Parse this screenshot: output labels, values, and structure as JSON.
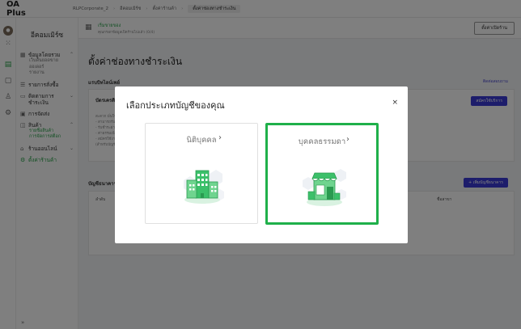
{
  "app": {
    "brand": "OA Plus"
  },
  "breadcrumb": [
    "RLPCorporate_2",
    "อีคอมเมิร์ซ",
    "ตั้งค่าร้านค้า",
    "ตั้งค่าช่องทางชำระเงิน"
  ],
  "sidebar": {
    "store_name": "อีคอมเมิร์ซ",
    "groups": [
      {
        "label": "ข้อมูลโดยรวม",
        "subs": [
          "เว็บดันยอดขาย",
          "ออเดอร์",
          "รายงาน"
        ]
      },
      {
        "label": "รายการสั่งซื้อ",
        "subs": []
      },
      {
        "label": "ติดตามการชำระเงิน",
        "subs": []
      },
      {
        "label": "การจัดส่ง",
        "subs": []
      },
      {
        "label": "สินค้า",
        "subs": [
          "รายชื่อสินค้า",
          "การจัดการสต็อก"
        ]
      },
      {
        "label": "ร้านออนไลน์",
        "subs": []
      },
      {
        "label": "ตั้งค่าร้านค้า",
        "subs": []
      }
    ],
    "collapse_icon": "double-chevron-icon"
  },
  "subheader": {
    "title": "เริ่มขายของ",
    "desc": "คุณกรอกข้อมูลเปิดร้านไปแล้ว (0/4)",
    "button": "ตั้งค่าเปิดร้าน"
  },
  "main": {
    "page_title": "ตั้งค่าช่องทางชำระเงิน",
    "section_online": "แรบบิทไลน์เพย์",
    "help_link": "ติดต่อสอบถาม",
    "card_title": "บัตรเครดิต",
    "card_button": "สมัครใช้บริการ",
    "card_lines": [
      "สะดวก มั่นใจ",
      "- สามารถรับ",
      "- รับชำระผ่าน",
      "- ค่าธรรมเนียม",
      "- สมัครใช้งานง่าย",
      "(สำหรับบัญชี)"
    ],
    "section_bank": "บัญชีธนาคาร",
    "add_bank_button": "+ เพิ่มบัญชีธนาคาร",
    "table_headers": [
      "ลำดับ",
      "ชื่อสาขา"
    ]
  },
  "modal": {
    "title": "เลือกประเภทบัญชีของคุณ",
    "close_label": "×",
    "options": [
      {
        "label": "นิติบุคคล",
        "chevron": "›",
        "icon": "buildings-icon"
      },
      {
        "label": "บุคคลธรรมดา",
        "chevron": "›",
        "icon": "storefront-icon"
      }
    ]
  },
  "colors": {
    "accent_green": "#1fb04a",
    "primary_blue": "#3a3ad6",
    "illustration_green": "#3cc06a"
  }
}
